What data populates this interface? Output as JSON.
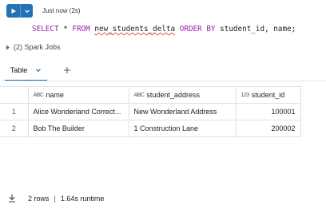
{
  "run_status": "Just now (2s)",
  "code": {
    "kw_select": "SELECT",
    "star": " * ",
    "kw_from": "FROM",
    "table": "new_students_delta",
    "kw_order": "ORDER BY",
    "cols": " student_id, name;"
  },
  "spark_jobs": "(2) Spark Jobs",
  "tabs": {
    "active": "Table"
  },
  "table": {
    "headers": [
      {
        "type_icon": "ABC",
        "label": "name"
      },
      {
        "type_icon": "ABC",
        "label": "student_address"
      },
      {
        "type_icon": "123",
        "label": "student_id"
      }
    ],
    "rows": [
      {
        "index": "1",
        "name": "Alice Wonderland Correct...",
        "student_address": "New Wonderland Address",
        "student_id": "100001"
      },
      {
        "index": "2",
        "name": "Bob The Builder",
        "student_address": "1 Construction Lane",
        "student_id": "200002"
      }
    ]
  },
  "footer": {
    "rows": "2 rows",
    "separator": "|",
    "runtime": "1.64s runtime"
  },
  "colors": {
    "accent": "#2272b4",
    "keyword": "#9a1fb0"
  },
  "icons": [
    "play-icon",
    "chevron-down-icon",
    "chevron-right-icon",
    "plus-icon",
    "download-icon",
    "abc-type-icon",
    "number-type-icon"
  ]
}
